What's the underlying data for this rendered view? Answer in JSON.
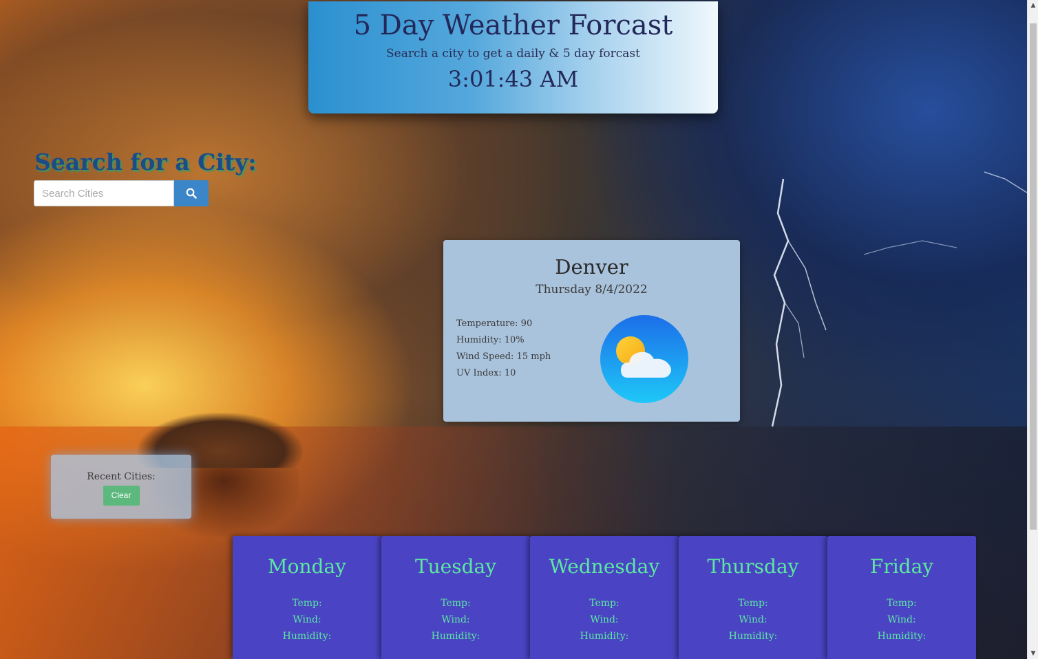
{
  "header": {
    "title": "5 Day Weather Forcast",
    "subtitle": "Search a city to get a daily & 5 day forcast",
    "clock": "3:01:43 AM"
  },
  "search": {
    "heading": "Search for a City:",
    "placeholder": "Search Cities",
    "button_icon": "search-icon"
  },
  "recent": {
    "label": "Recent Cities:",
    "clear_label": "Clear"
  },
  "current": {
    "city": "Denver",
    "date": "Thursday 8/4/2022",
    "stats": [
      "Temperature: 90",
      "Humidity: 10%",
      "Wind Speed: 15 mph",
      "UV Index: 10"
    ],
    "icon": "partly-cloudy-icon"
  },
  "forecast": [
    {
      "day": "Monday",
      "temp": "Temp:",
      "wind": "Wind:",
      "humidity": "Humidity:"
    },
    {
      "day": "Tuesday",
      "temp": "Temp:",
      "wind": "Wind:",
      "humidity": "Humidity:"
    },
    {
      "day": "Wednesday",
      "temp": "Temp:",
      "wind": "Wind:",
      "humidity": "Humidity:"
    },
    {
      "day": "Thursday",
      "temp": "Temp:",
      "wind": "Wind:",
      "humidity": "Humidity:"
    },
    {
      "day": "Friday",
      "temp": "Temp:",
      "wind": "Wind:",
      "humidity": "Humidity:"
    }
  ],
  "colors": {
    "header_gradient_start": "#2b90d0",
    "header_gradient_end": "#f0f8fc",
    "current_card_bg": "#a9c3dc",
    "forecast_card_bg": "#4a44c4",
    "forecast_text": "#5de8a0",
    "search_button": "#3a86c8",
    "clear_button": "#5cb87c",
    "search_heading": "#1d4b86"
  }
}
